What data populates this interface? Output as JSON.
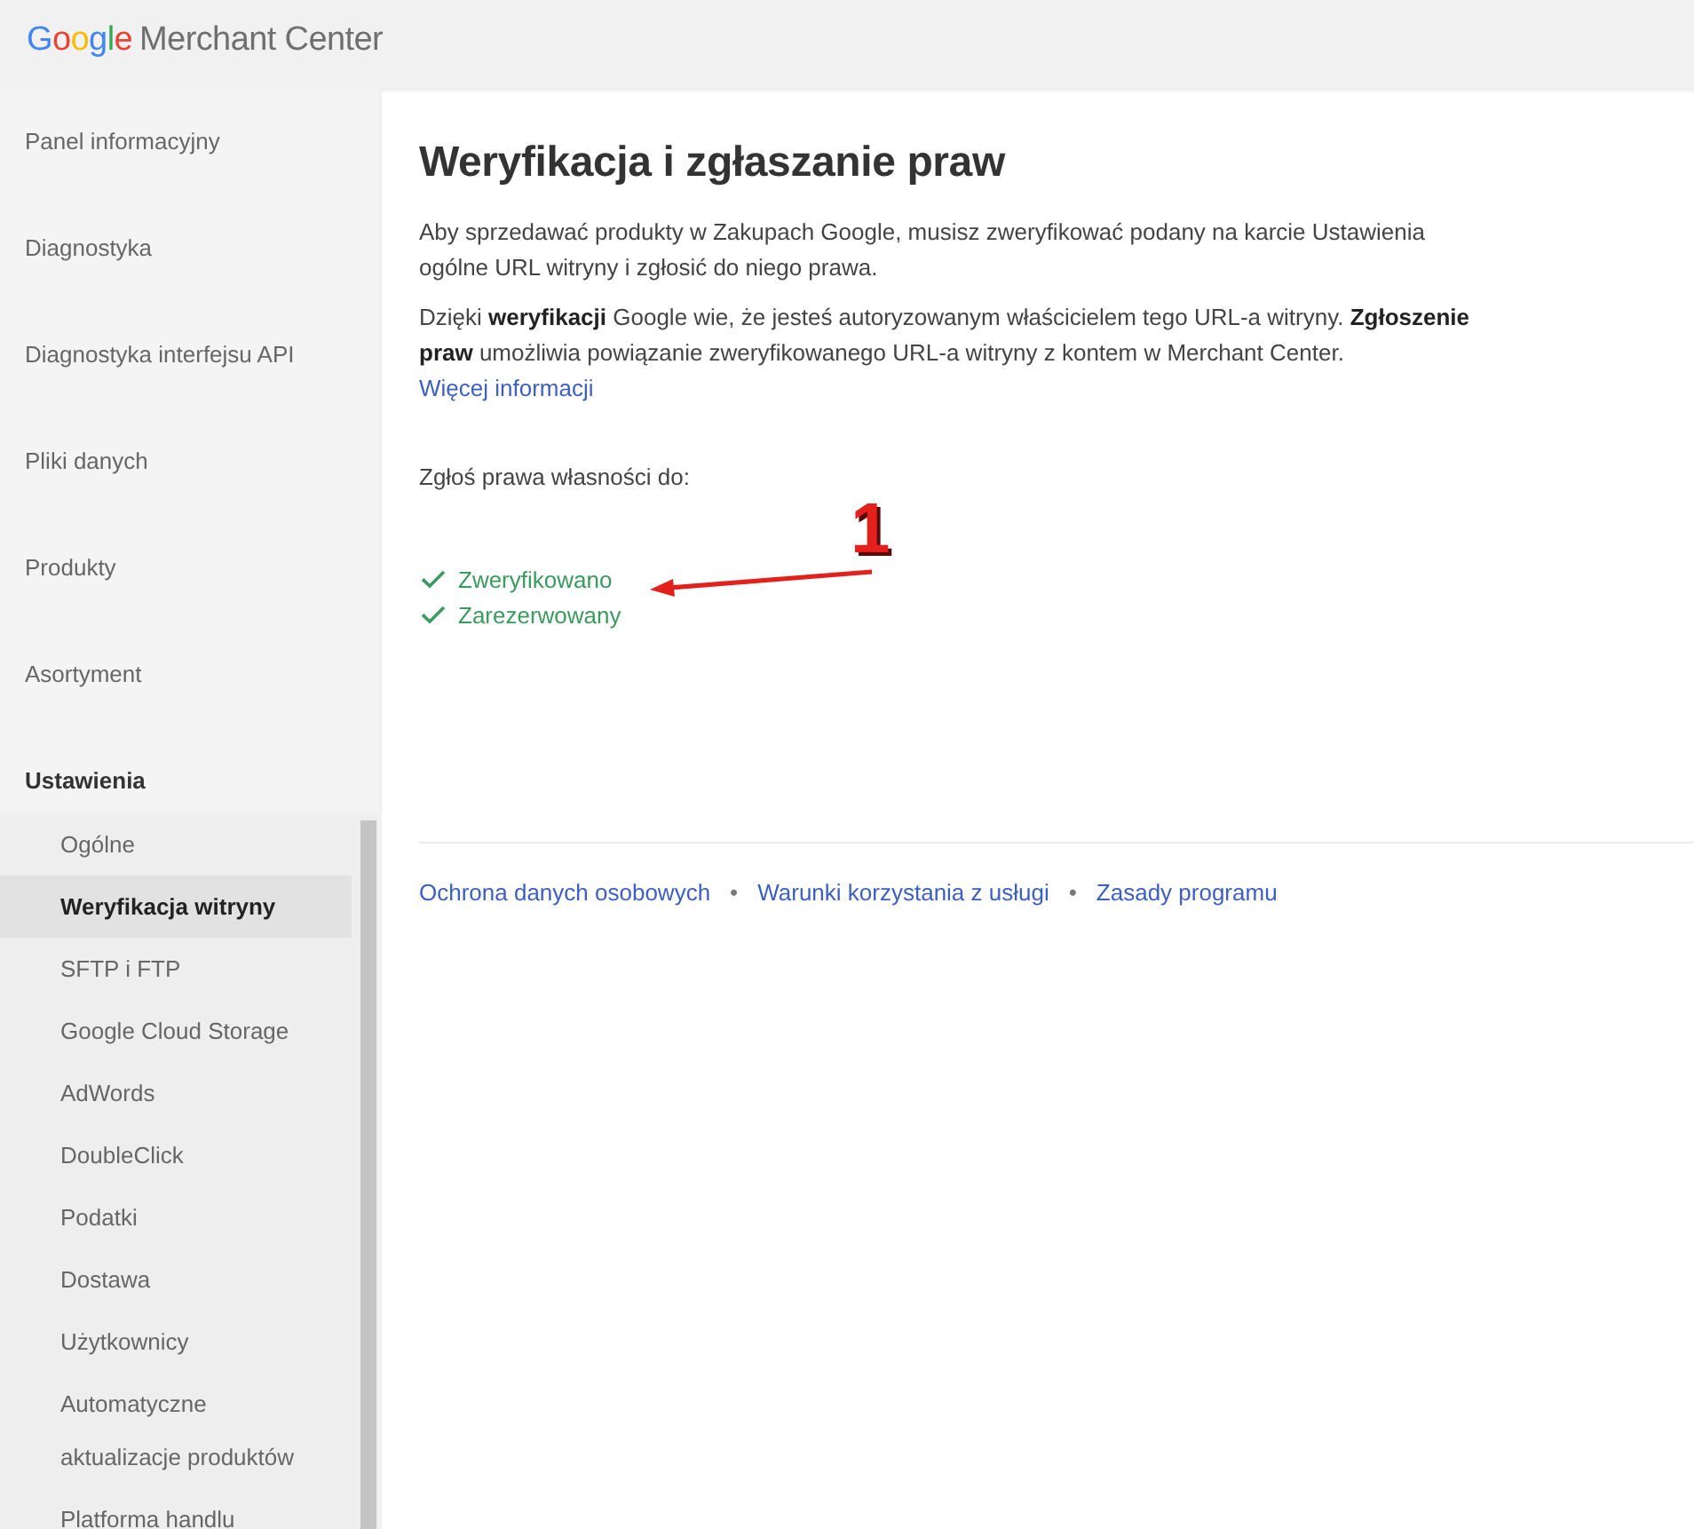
{
  "header": {
    "logo": {
      "brand": "Google",
      "product": "Merchant Center"
    }
  },
  "sidebar": {
    "items": [
      {
        "label": "Panel informacyjny",
        "selected": false
      },
      {
        "label": "Diagnostyka",
        "selected": false
      },
      {
        "label": "Diagnostyka interfejsu API",
        "selected": false
      },
      {
        "label": "Pliki danych",
        "selected": false
      },
      {
        "label": "Produkty",
        "selected": false
      },
      {
        "label": "Asortyment",
        "selected": false
      },
      {
        "label": "Ustawienia",
        "selected": false,
        "expanded": true,
        "children": [
          {
            "label": "Ogólne",
            "selected": false
          },
          {
            "label": "Weryfikacja witryny",
            "selected": true
          },
          {
            "label": "SFTP i FTP",
            "selected": false
          },
          {
            "label": "Google Cloud Storage",
            "selected": false
          },
          {
            "label": "AdWords",
            "selected": false
          },
          {
            "label": "DoubleClick",
            "selected": false
          },
          {
            "label": "Podatki",
            "selected": false
          },
          {
            "label": "Dostawa",
            "selected": false
          },
          {
            "label": "Użytkownicy",
            "selected": false
          },
          {
            "label": "Automatyczne aktualizacje produktów",
            "selected": false
          },
          {
            "label": "Platforma handlu",
            "selected": false
          }
        ]
      }
    ]
  },
  "main": {
    "title": "Weryfikacja i zgłaszanie praw",
    "paragraphs": [
      {
        "text": "Aby sprzedawać produkty w Zakupach Google, musisz zweryfikować podany na karcie Ustawienia ogólne URL witryny i zgłosić do niego prawa."
      },
      {
        "text": "Dzięki **weryfikacji** Google wie, że jesteś autoryzowanym właścicielem tego URL-a witryny. **Zgłoszenie praw** umożliwia powiązanie zweryfikowanego URL-a witryny z kontem w Merchant Center.",
        "link": "Więcej informacji"
      }
    ],
    "claim_label": "Zgłoś prawa własności do:",
    "statuses": [
      {
        "label": "Zweryfikowano",
        "checked": true
      },
      {
        "label": "Zarezerwowany",
        "checked": true
      }
    ],
    "annotation": {
      "label": "1"
    }
  },
  "footer": {
    "items": [
      {
        "kind": "link",
        "text": "Ochrona danych osobowych"
      },
      {
        "kind": "separator",
        "text": "•"
      },
      {
        "kind": "link",
        "text": "Warunki korzystania z usługi"
      },
      {
        "kind": "separator",
        "text": "•"
      },
      {
        "kind": "link",
        "text": "Zasady programu"
      }
    ]
  }
}
